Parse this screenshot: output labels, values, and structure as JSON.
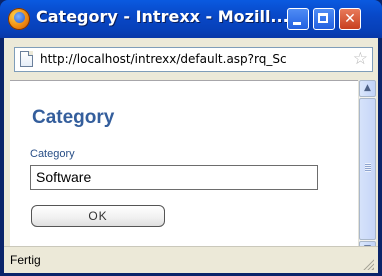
{
  "window": {
    "title": "Category - Intrexx - Mozill...",
    "controls": {
      "minimize": "_",
      "maximize": "□",
      "close": "✕"
    }
  },
  "addressbar": {
    "url": "http://localhost/intrexx/default.asp?rq_Sc",
    "page_icon": "page-icon",
    "bookmark_icon": "star-icon"
  },
  "content": {
    "heading": "Category",
    "field_label": "Category",
    "field_value": "Software",
    "ok_label": "OK"
  },
  "scrollbar": {
    "up": "▲",
    "down": "▼"
  },
  "status": {
    "text": "Fertig"
  }
}
